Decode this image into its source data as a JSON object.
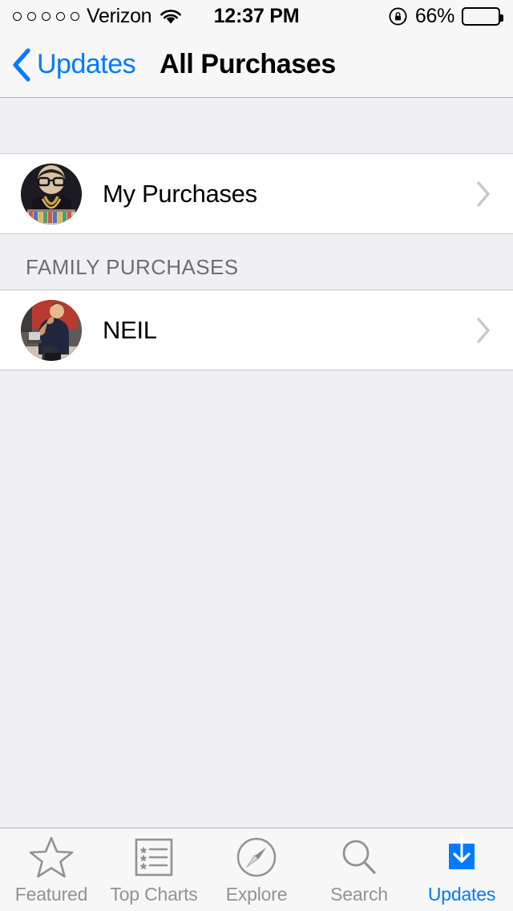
{
  "status_bar": {
    "signal_dots": 5,
    "signal_filled": 0,
    "carrier": "Verizon",
    "wifi_icon": "wifi-icon",
    "time": "12:37 PM",
    "rotation_lock_icon": "rotation-lock-icon",
    "battery_percent": "66%",
    "battery_level": 66
  },
  "nav_bar": {
    "back_icon": "chevron-left-icon",
    "back_label": "Updates",
    "title": "All Purchases"
  },
  "content": {
    "my_purchases": {
      "label": "My Purchases",
      "avatar_name": "user-avatar-my-purchases",
      "disclosure_icon": "chevron-right-icon"
    },
    "family_section": {
      "header": "FAMILY PURCHASES",
      "members": [
        {
          "label": "NEIL",
          "avatar_name": "user-avatar-neil",
          "disclosure_icon": "chevron-right-icon"
        }
      ]
    }
  },
  "tab_bar": {
    "active_tab": "Updates",
    "accent_color": "#007aff",
    "inactive_color": "#929292",
    "tabs": [
      {
        "label": "Featured",
        "icon": "star-icon",
        "active": false
      },
      {
        "label": "Top Charts",
        "icon": "ranked-list-icon",
        "active": false
      },
      {
        "label": "Explore",
        "icon": "compass-icon",
        "active": false
      },
      {
        "label": "Search",
        "icon": "magnifier-icon",
        "active": false
      },
      {
        "label": "Updates",
        "icon": "download-box-icon",
        "active": true
      }
    ]
  }
}
